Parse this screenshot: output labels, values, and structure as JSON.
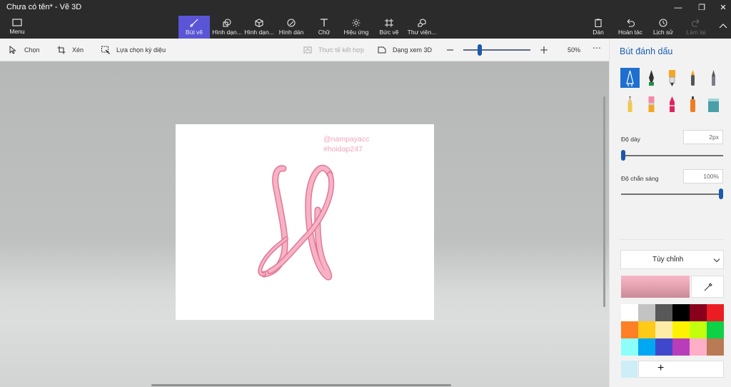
{
  "window": {
    "title": "Chưa có tên* - Vẽ 3D"
  },
  "ribbon": {
    "menu": "Menu",
    "tools": [
      {
        "label": "Bút vẽ",
        "icon": "brush-icon"
      },
      {
        "label": "Hình dạn...",
        "icon": "shapes-2d-icon"
      },
      {
        "label": "Hình dạn...",
        "icon": "shapes-3d-icon"
      },
      {
        "label": "Hình dán",
        "icon": "stickers-icon"
      },
      {
        "label": "Chữ",
        "icon": "text-icon"
      },
      {
        "label": "Hiệu ứng",
        "icon": "effects-icon"
      },
      {
        "label": "Bức vẽ",
        "icon": "canvas-icon"
      },
      {
        "label": "Thư viện...",
        "icon": "library-icon"
      }
    ],
    "actions": {
      "paste": "Dán",
      "undo": "Hoàn tác",
      "history": "Lịch sử",
      "redo": "Làm lại"
    }
  },
  "toolbar": {
    "select": "Chọn",
    "crop": "Xén",
    "magic_select": "Lựa chọn kỳ diệu",
    "mixed_reality": "Thực tế kết hợp",
    "view_3d": "Dạng xem 3D",
    "zoom": "50%",
    "zoom_level": 0.23
  },
  "canvas": {
    "watermark1": "@nampayacc",
    "watermark2": "#hoidap247",
    "letter_color": "#f4a6bf"
  },
  "panel": {
    "title": "Bút đánh dấu",
    "thickness_label": "Độ dày",
    "thickness_value": "2px",
    "thickness_level": 0.0,
    "opacity_label": "Độ chắn sáng",
    "opacity_value": "100%",
    "opacity_level": 1.0,
    "color_mode": "Tùy chỉnh",
    "add_color": "+",
    "accent": "#1a5aa8",
    "swatches": [
      "#ffffff",
      "#c3c3c3",
      "#585858",
      "#000000",
      "#88001b",
      "#ec1c24",
      "#ff7f27",
      "#ffca18",
      "#fdeca6",
      "#fff200",
      "#c4ff0e",
      "#0ed145",
      "#8cfffb",
      "#00a8f3",
      "#3f48cc",
      "#b83dba",
      "#ffaec8",
      "#b97a56"
    ],
    "last_swatch": "#cdeef6"
  }
}
